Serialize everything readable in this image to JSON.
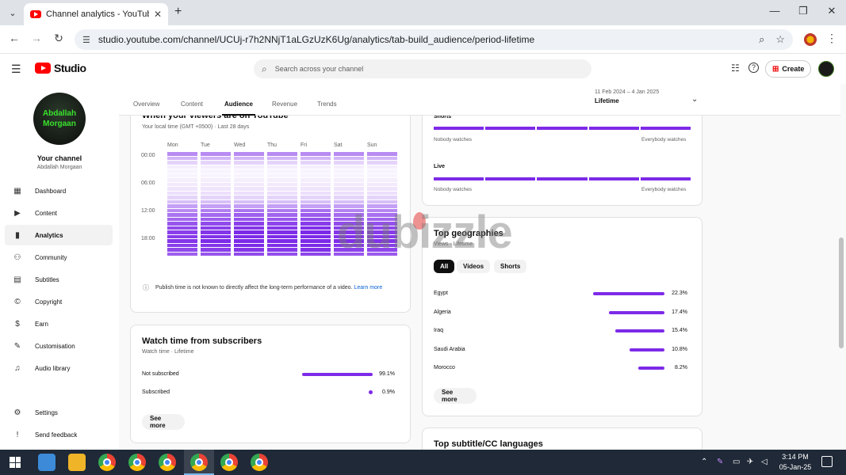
{
  "browser": {
    "tab_title": "Channel analytics - YouTube Studio",
    "tab_close": "✕",
    "new_tab": "+",
    "url": "studio.youtube.com/channel/UCUj-r7h2NNjT1aLGzUzK6Ug/analytics/tab-build_audience/period-lifetime",
    "win_minimize": "—",
    "win_restore": "❐",
    "win_close": "✕"
  },
  "studio_header": {
    "logo_text": "Studio",
    "search_placeholder": "Search across your channel",
    "create_label": "Create"
  },
  "sidebar": {
    "avatar_line1": "Abdallah",
    "avatar_line2": "Morgaan",
    "your_channel": "Your channel",
    "channel_name": "Abdallah Morgaan",
    "items": [
      {
        "label": "Dashboard",
        "icon": "dashboard-icon",
        "glyph": "▦"
      },
      {
        "label": "Content",
        "icon": "content-icon",
        "glyph": "▶"
      },
      {
        "label": "Analytics",
        "icon": "analytics-icon",
        "glyph": "▮"
      },
      {
        "label": "Community",
        "icon": "community-icon",
        "glyph": "⚇"
      },
      {
        "label": "Subtitles",
        "icon": "subtitles-icon",
        "glyph": "▤"
      },
      {
        "label": "Copyright",
        "icon": "copyright-icon",
        "glyph": "©"
      },
      {
        "label": "Earn",
        "icon": "dollar-icon",
        "glyph": "$"
      },
      {
        "label": "Customisation",
        "icon": "wand-icon",
        "glyph": "✎"
      },
      {
        "label": "Audio library",
        "icon": "audio-library-icon",
        "glyph": "♫"
      }
    ],
    "bottom_items": [
      {
        "label": "Settings",
        "icon": "gear-icon",
        "glyph": "⚙"
      },
      {
        "label": "Send feedback",
        "icon": "feedback-icon",
        "glyph": "!"
      }
    ]
  },
  "subtabs": [
    "Overview",
    "Content",
    "Audience",
    "Revenue",
    "Trends"
  ],
  "active_subtab": "Audience",
  "date_range": {
    "dates": "11 Feb 2024 – 4 Jan 2025",
    "label": "Lifetime"
  },
  "viewers_card": {
    "title": "When your viewers are on YouTube",
    "subtitle": "Your local time (GMT +0500) · Last 28 days",
    "days": [
      "Mon",
      "Tue",
      "Wed",
      "Thu",
      "Fri",
      "Sat",
      "Sun"
    ],
    "hours": [
      "00:00",
      "06:00",
      "12:00",
      "18:00"
    ],
    "note": "Publish time is not known to directly affect the long-term performance of a video.",
    "learn_more": "Learn more",
    "accent_color": "#7d2ae8",
    "heat_intensity_by_hour_band": [
      0.55,
      0.35,
      0.2,
      0.08,
      0.05,
      0.05,
      0.08,
      0.1,
      0.12,
      0.15,
      0.2,
      0.3,
      0.45,
      0.55,
      0.65,
      0.7,
      0.8,
      0.85,
      0.9,
      0.92,
      0.95,
      0.9,
      0.85,
      0.75
    ]
  },
  "subs_card": {
    "title": "Watch time from subscribers",
    "subtitle": "Watch time · Lifetime",
    "rows": [
      {
        "label": "Not subscribed",
        "value": "99.1%",
        "share": 0.991
      },
      {
        "label": "Subscribed",
        "value": "0.9%",
        "share": 0.009
      }
    ],
    "see_more": "See more"
  },
  "returning_card": {
    "rows": [
      {
        "label": "Shorts",
        "left": "Nobody watches",
        "right": "Everybody watches"
      },
      {
        "label": "Live",
        "left": "Nobody watches",
        "right": "Everybody watches"
      }
    ]
  },
  "geo_card": {
    "title": "Top geographies",
    "subtitle": "Views · Lifetime",
    "chips": [
      "All",
      "Videos",
      "Shorts"
    ],
    "active_chip": "All",
    "rows": [
      {
        "label": "Egypt",
        "value": "22.3%",
        "share": 0.223
      },
      {
        "label": "Algeria",
        "value": "17.4%",
        "share": 0.174
      },
      {
        "label": "Iraq",
        "value": "15.4%",
        "share": 0.154
      },
      {
        "label": "Saudi Arabia",
        "value": "10.8%",
        "share": 0.108
      },
      {
        "label": "Morocco",
        "value": "8.2%",
        "share": 0.082
      }
    ],
    "see_more": "See more"
  },
  "subtitle_card": {
    "title": "Top subtitle/CC languages"
  },
  "watermark": "dubizzle",
  "taskbar": {
    "time": "3:14 PM",
    "date": "05-Jan-25"
  }
}
